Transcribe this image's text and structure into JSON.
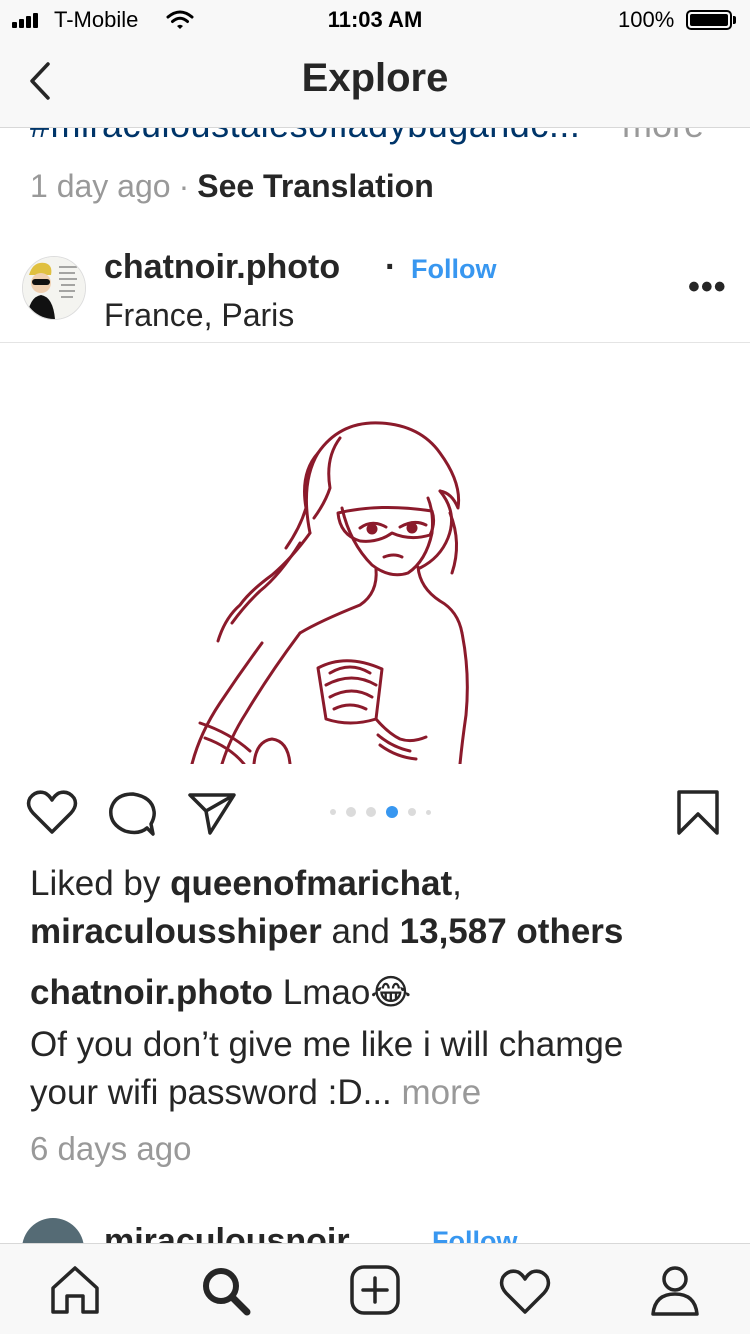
{
  "status_bar": {
    "carrier": "T-Mobile",
    "time": "11:03 AM",
    "battery": "100%",
    "battery_level": 1.0
  },
  "nav": {
    "title": "Explore",
    "back_icon": "chevron-left-icon"
  },
  "previous_post": {
    "hashtag": "#miraculoustalesofladybugandc...",
    "more": "more",
    "time": "1 day ago",
    "separator": "·",
    "see_translation": "See Translation"
  },
  "post": {
    "username": "chatnoir.photo",
    "separator": "·",
    "follow_label": "Follow",
    "location": "France, Paris",
    "more_options": "•••",
    "carousel": {
      "count": 6,
      "active_index": 3
    },
    "likes": {
      "prefix": "Liked by",
      "user1": "queenofmarichat",
      "comma": ",",
      "user2": "miraculousshiper",
      "and": "and",
      "others": "13,587 others"
    },
    "caption": {
      "username": "chatnoir.photo",
      "text": "Lmao",
      "emoji": "😂",
      "line2": "Of you don’t give me like i will chamge",
      "line3": "your wifi password :D...",
      "more": "more"
    },
    "time": "6 days ago"
  },
  "next_post": {
    "username": "miraculousnoir",
    "follow_label": "Follow"
  },
  "tab_bar": {
    "tabs": [
      "home-icon",
      "search-icon",
      "add-post-icon",
      "activity-heart-icon",
      "profile-icon"
    ],
    "active": "search-icon"
  },
  "colors": {
    "link_blue": "#3897f0",
    "hashtag_blue": "#003569",
    "muted_gray": "#999999",
    "drawing_line": "#8b1a2b"
  }
}
